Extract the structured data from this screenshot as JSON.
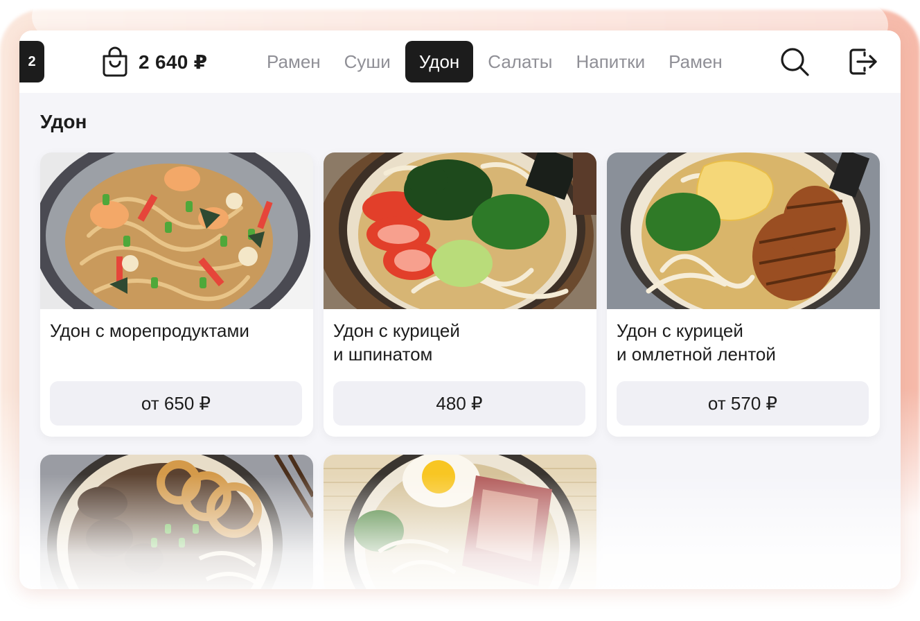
{
  "header": {
    "table_number": "2",
    "cart_total": "2 640 ₽",
    "icons": [
      "bag-icon",
      "search-icon",
      "logout-icon"
    ]
  },
  "tabs": [
    {
      "label": "Рамен",
      "active": false
    },
    {
      "label": "Суши",
      "active": false
    },
    {
      "label": "Удон",
      "active": true
    },
    {
      "label": "Салаты",
      "active": false
    },
    {
      "label": "Напитки",
      "active": false
    },
    {
      "label": "Рамен",
      "active": false
    }
  ],
  "section": {
    "title": "Удон"
  },
  "products": [
    {
      "name": "Удон с морепродуктами",
      "price": "от 650 ₽"
    },
    {
      "name": "Удон с курицей\nи шпинатом",
      "price": "480 ₽"
    },
    {
      "name": "Удон с курицей\nи омлетной лентой",
      "price": "от 570 ₽"
    }
  ],
  "colors": {
    "accent": "#1c1c1c",
    "tab_inactive": "#8f8f96",
    "surface": "#f5f5f9",
    "price_button": "#f0f0f5",
    "glow_left": "#fbe7dc",
    "glow_right": "#f6b7a6"
  }
}
